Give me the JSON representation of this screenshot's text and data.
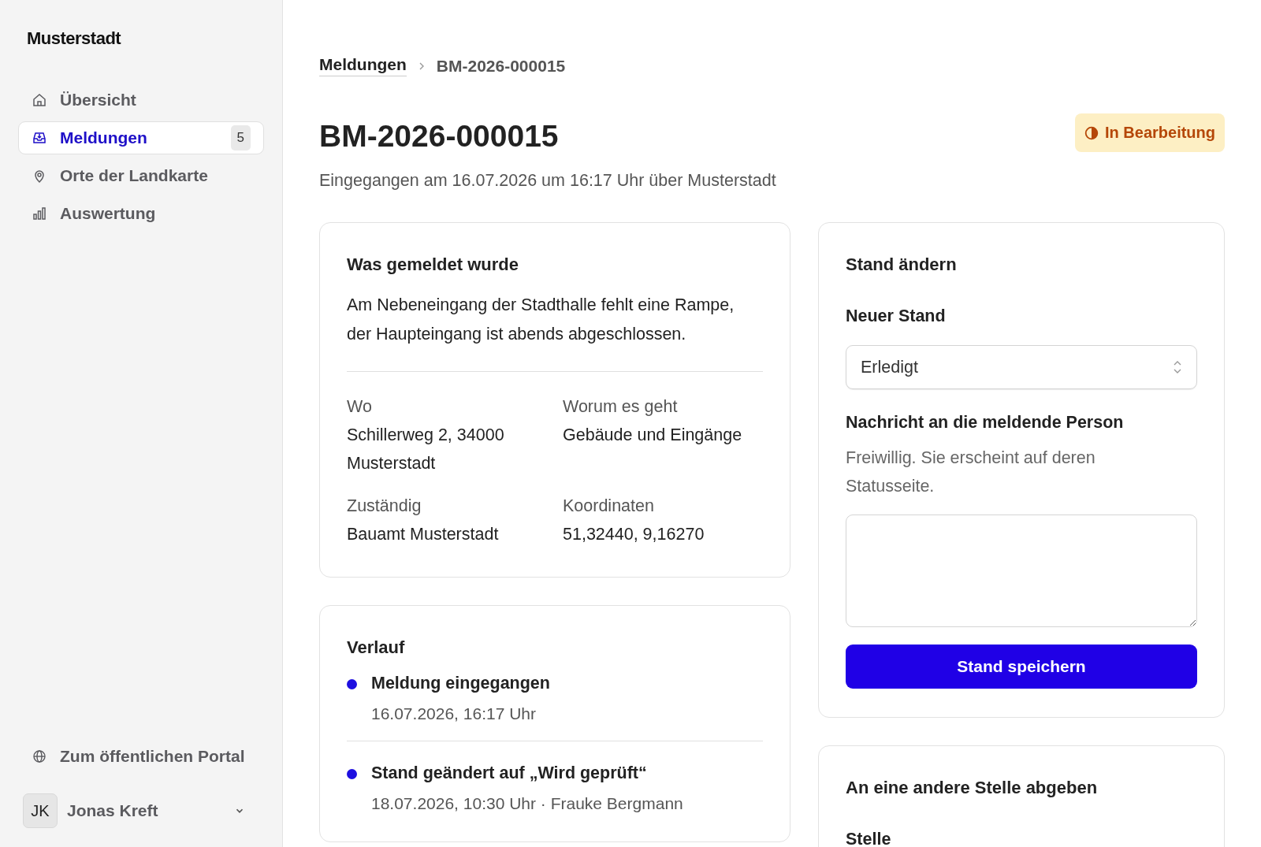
{
  "sidebar": {
    "brand": "Musterstadt",
    "nav": [
      {
        "label": "Übersicht",
        "kind": "home",
        "selected": false
      },
      {
        "label": "Meldungen",
        "kind": "inbox",
        "selected": true,
        "badge": "5"
      },
      {
        "label": "Orte der Landkarte",
        "kind": "pin",
        "selected": false
      },
      {
        "label": "Auswertung",
        "kind": "chart",
        "selected": false
      }
    ],
    "portal_link": "Zum öffentlichen Portal",
    "user": {
      "initials": "JK",
      "name": "Jonas Kreft"
    }
  },
  "breadcrumb": [
    {
      "label": "Meldungen",
      "kind": "link"
    },
    {
      "label": "BM-2026-000015",
      "kind": "current"
    }
  ],
  "header": {
    "title": "BM-2026-000015",
    "subtitle": "Eingegangen am 16.07.2026 um 16:17 Uhr über Musterstadt",
    "status": "In Bearbeitung"
  },
  "report": {
    "title": "Was gemeldet wurde",
    "description": "Am Nebeneingang der Stadthalle fehlt eine Rampe, der Haupteingang ist abends abgeschlossen.",
    "fields": [
      {
        "label": "Wo",
        "value": "Schillerweg 2, 34000 Musterstadt"
      },
      {
        "label": "Worum es geht",
        "value": "Gebäude und Eingänge"
      },
      {
        "label": "Zuständig",
        "value": "Bauamt Musterstadt"
      },
      {
        "label": "Koordinaten",
        "value": "51,32440, 9,16270"
      }
    ]
  },
  "history": {
    "title": "Verlauf",
    "entries": [
      {
        "title": "Meldung eingegangen",
        "meta": "16.07.2026, 16:17 Uhr"
      },
      {
        "title": "Stand geändert auf „Wird geprüft“",
        "meta": "18.07.2026, 10:30 Uhr · Frauke Bergmann"
      }
    ]
  },
  "status_form": {
    "title": "Stand ändern",
    "select_label": "Neuer Stand",
    "select_value": "Erledigt",
    "message_label": "Nachricht an die meldende Person",
    "message_hint": "Freiwillig. Sie erscheint auf deren Statusseite.",
    "button": "Stand speichern"
  },
  "handover": {
    "title": "An eine andere Stelle abgeben",
    "field_label": "Stelle"
  }
}
